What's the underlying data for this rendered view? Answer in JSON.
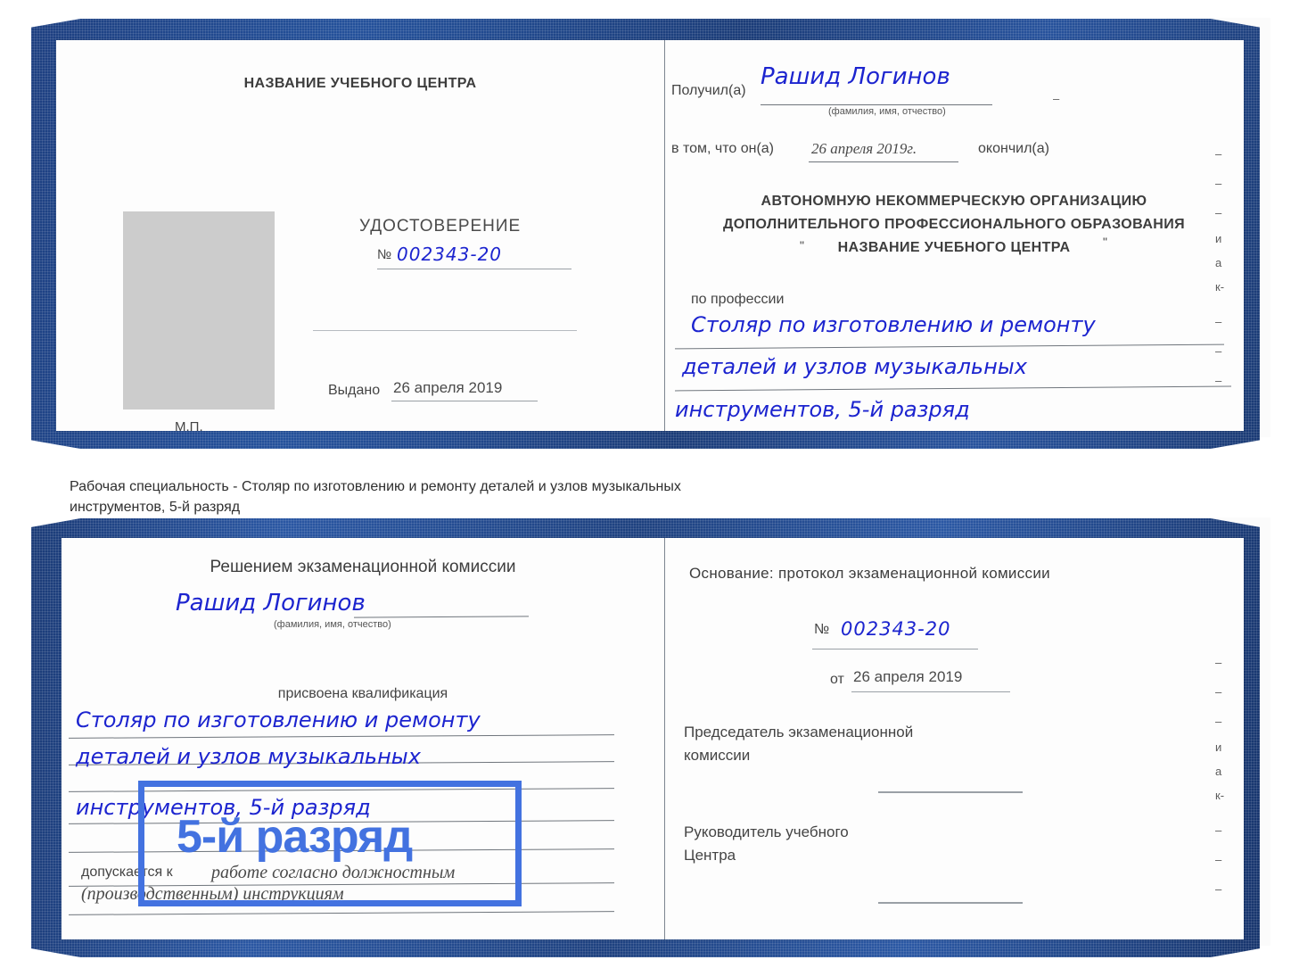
{
  "document": {
    "type": "certificate-scan",
    "language": "ru"
  },
  "top_certificate": {
    "left_page": {
      "header": "НАЗВАНИЕ УЧЕБНОГО ЦЕНТРА",
      "title": "УДОСТОВЕРЕНИЕ",
      "number_label": "№",
      "number_value": "002343-20",
      "issued_label": "Выдано",
      "issued_value": "26 апреля 2019",
      "stamp_label": "М.П.",
      "photo_alt": "photo-placeholder"
    },
    "right_page": {
      "received_label": "Получил(а)",
      "received_value": "Рашид Логинов",
      "fio_hint": "(фамилия, имя, отчество)",
      "in_that_label": "в том, что он(а)",
      "in_that_value": "26 апреля 2019г.",
      "finished_label": "окончил(а)",
      "org_line1": "АВТОНОМНУЮ НЕКОММЕРЧЕСКУЮ ОРГАНИЗАЦИЮ",
      "org_line2": "ДОПОЛНИТЕЛЬНОГО ПРОФЕССИОНАЛЬНОГО ОБРАЗОВАНИЯ",
      "org_quote_open": "\"",
      "org_line3": "НАЗВАНИЕ УЧЕБНОГО ЦЕНТРА",
      "org_quote_close": "\"",
      "profession_label": "по профессии",
      "profession_line1": "Столяр по изготовлению и ремонту",
      "profession_line2": "деталей и узлов музыкальных",
      "profession_line3": "инструментов, 5-й разряд"
    },
    "edge_marks": [
      "–",
      "–",
      "–",
      "и",
      "а",
      "к-",
      "–",
      "–",
      "–"
    ]
  },
  "caption": {
    "line1": "Рабочая специальность - Столяр по изготовлению и ремонту деталей и узлов музыкальных",
    "line2": "инструментов, 5-й разряд"
  },
  "bottom_certificate": {
    "left_page": {
      "header": "Решением экзаменационной комиссии",
      "name_value": "Рашид Логинов",
      "fio_hint": "(фамилия, имя, отчество)",
      "qualification_label": "присвоена квалификация",
      "qualification_line1": "Столяр по изготовлению и ремонту",
      "qualification_line2": "деталей и узлов музыкальных",
      "qualification_line3": "инструментов, 5-й разряд",
      "admitted_label": "допускается к",
      "admitted_value_line1": "работе согласно должностным",
      "admitted_value_line2": "(производственным) инструкциям"
    },
    "right_page": {
      "basis_label": "Основание: протокол экзаменационной комиссии",
      "number_label": "№",
      "number_value": "002343-20",
      "date_label": "от",
      "date_value": "26 апреля 2019",
      "chairman_line1": "Председатель экзаменационной",
      "chairman_line2": "комиссии",
      "head_line1": "Руководитель учебного",
      "head_line2": "Центра"
    },
    "edge_marks": [
      "–",
      "–",
      "–",
      "и",
      "а",
      "к-",
      "–",
      "–",
      "–"
    ]
  },
  "annotation": {
    "highlight_text": "5-й разряд",
    "highlight_color": "#4372e0"
  },
  "colors": {
    "cover_blue": "#1f4489",
    "ink_blue": "#1c24cf",
    "highlight_blue": "#4372e0",
    "photo_gray": "#cccccc",
    "page_white": "#fdfdfd"
  }
}
